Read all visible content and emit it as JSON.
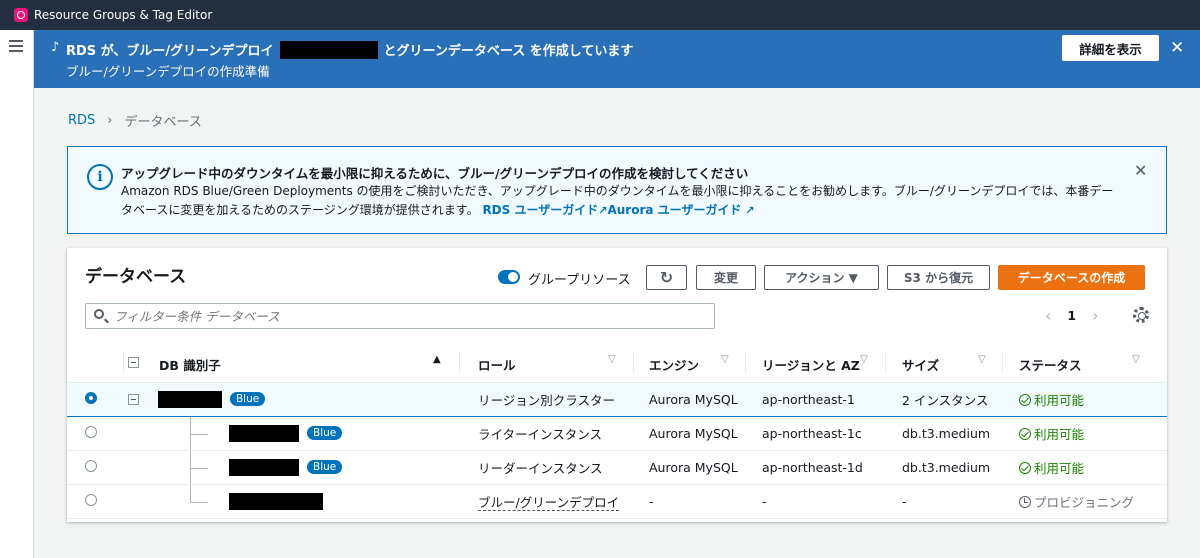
{
  "topbar": {
    "title": "Resource Groups & Tag Editor"
  },
  "flash": {
    "spinner": "♪",
    "line1_prefix": "RDS が、ブルー/グリーンデプロイ",
    "line1_suffix": "とグリーンデータベース を作成しています",
    "line2": "ブルー/グリーンデプロイの作成準備",
    "detail_button": "詳細を表示",
    "close": "✕"
  },
  "breadcrumb": {
    "items": [
      "RDS",
      "データベース"
    ],
    "separator": "›"
  },
  "info": {
    "icon": "i",
    "heading": "アップグレード中のダウンタイムを最小限に抑えるために、ブルー/グリーンデプロイの作成を検討してください",
    "body": "Amazon RDS Blue/Green Deployments の使用をご検討いただき、アップグレード中のダウンタイムを最小限に抑えることをお勧めします。ブルー/グリーンデプロイでは、本番データベースに変更を加えるためのステージング環境が提供されます。",
    "link1": "RDS ユーザーガイド",
    "link2": "Aurora ユーザーガイド",
    "ext_icon": "↗",
    "close": "✕"
  },
  "panel": {
    "title": "データベース",
    "group_toggle_label": "グループリソース",
    "refresh_icon": "↻",
    "modify": "変更",
    "actions": "アクション ▼",
    "restore_s3": "S3 から復元",
    "create": "データベースの作成",
    "search_placeholder": "フィルター条件 データベース",
    "page": "1",
    "prev": "‹",
    "next": "›"
  },
  "table": {
    "headers": {
      "id": "DB 識別子",
      "role": "ロール",
      "engine": "エンジン",
      "region": "リージョンと AZ",
      "size": "サイズ",
      "status": "ステータス"
    },
    "sort_up": "▲",
    "sort_down": "▽",
    "rows": [
      {
        "badge": "Blue",
        "role": "リージョン別クラスター",
        "engine": "Aurora MySQL",
        "region": "ap-northeast-1",
        "size": "2 インスタンス",
        "status": "利用可能"
      },
      {
        "badge": "Blue",
        "role": "ライターインスタンス",
        "engine": "Aurora MySQL",
        "region": "ap-northeast-1c",
        "size": "db.t3.medium",
        "status": "利用可能"
      },
      {
        "badge": "Blue",
        "role": "リーダーインスタンス",
        "engine": "Aurora MySQL",
        "region": "ap-northeast-1d",
        "size": "db.t3.medium",
        "status": "利用可能"
      },
      {
        "badge": "",
        "role": "ブルー/グリーンデプロイ",
        "engine": "-",
        "region": "-",
        "size": "-",
        "status": "プロビジョニング"
      }
    ]
  },
  "colors": {
    "accent": "#0073bb",
    "flash": "#2a70b8",
    "primary_button": "#ec7211",
    "success": "#1d8102"
  }
}
